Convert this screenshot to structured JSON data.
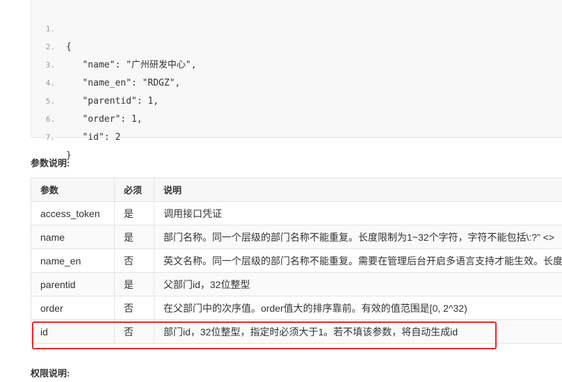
{
  "code_lines": [
    {
      "num": "1.",
      "text": "{"
    },
    {
      "num": "2.",
      "text": "   \"name\": \"广州研发中心\","
    },
    {
      "num": "3.",
      "text": "   \"name_en\": \"RDGZ\","
    },
    {
      "num": "4.",
      "text": "   \"parentid\": 1,"
    },
    {
      "num": "5.",
      "text": "   \"order\": 1,"
    },
    {
      "num": "6.",
      "text": "   \"id\": 2"
    },
    {
      "num": "7.",
      "text": "}"
    }
  ],
  "params_heading": "参数说明:",
  "permissions_heading": "权限说明:",
  "table": {
    "headers": [
      "参数",
      "必须",
      "说明"
    ],
    "rows": [
      [
        "access_token",
        "是",
        "调用接口凭证"
      ],
      [
        "name",
        "是",
        "部门名称。同一个层级的部门名称不能重复。长度限制为1~32个字符，字符不能包括\\:?” <>"
      ],
      [
        "name_en",
        "否",
        "英文名称。同一个层级的部门名称不能重复。需要在管理后台开启多语言支持才能生效。长度"
      ],
      [
        "parentid",
        "是",
        "父部门id，32位整型"
      ],
      [
        "order",
        "否",
        "在父部门中的次序值。order值大的排序靠前。有效的值范围是[0, 2^32)"
      ],
      [
        "id",
        "否",
        "部门id，32位整型，指定时必须大于1。若不填该参数，将自动生成id"
      ]
    ]
  },
  "colors": {
    "highlight_border": "#e8262a",
    "code_bg": "#f8f8f8"
  }
}
